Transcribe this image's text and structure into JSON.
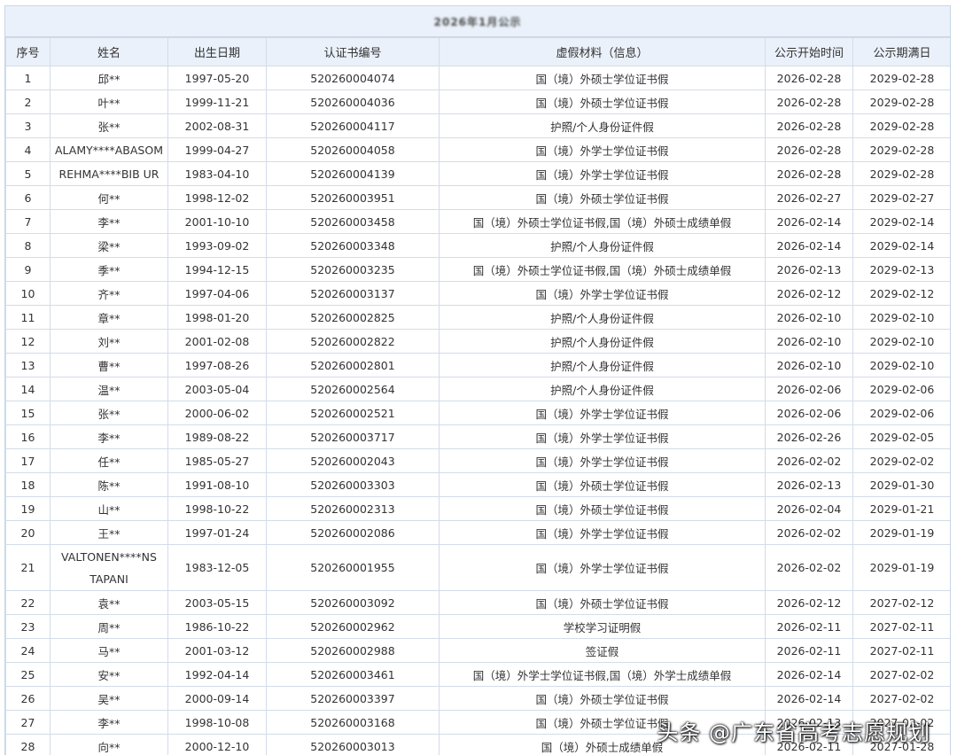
{
  "title": "2026年1月公示",
  "columns": [
    "序号",
    "姓名",
    "出生日期",
    "认证书编号",
    "虚假材料（信息）",
    "公示开始时间",
    "公示期满日"
  ],
  "rows": [
    [
      "1",
      "邱**",
      "1997-05-20",
      "520260004074",
      "国（境）外硕士学位证书假",
      "2026-02-28",
      "2029-02-28"
    ],
    [
      "2",
      "叶**",
      "1999-11-21",
      "520260004036",
      "国（境）外硕士学位证书假",
      "2026-02-28",
      "2029-02-28"
    ],
    [
      "3",
      "张**",
      "2002-08-31",
      "520260004117",
      "护照/个人身份证件假",
      "2026-02-28",
      "2029-02-28"
    ],
    [
      "4",
      "ALAMY****ABASOM",
      "1999-04-27",
      "520260004058",
      "国（境）外学士学位证书假",
      "2026-02-28",
      "2029-02-28"
    ],
    [
      "5",
      "REHMA****BIB UR",
      "1983-04-10",
      "520260004139",
      "国（境）外学士学位证书假",
      "2026-02-28",
      "2029-02-28"
    ],
    [
      "6",
      "何**",
      "1998-12-02",
      "520260003951",
      "国（境）外硕士学位证书假",
      "2026-02-27",
      "2029-02-27"
    ],
    [
      "7",
      "李**",
      "2001-10-10",
      "520260003458",
      "国（境）外硕士学位证书假,国（境）外硕士成绩单假",
      "2026-02-14",
      "2029-02-14"
    ],
    [
      "8",
      "梁**",
      "1993-09-02",
      "520260003348",
      "护照/个人身份证件假",
      "2026-02-14",
      "2029-02-14"
    ],
    [
      "9",
      "季**",
      "1994-12-15",
      "520260003235",
      "国（境）外硕士学位证书假,国（境）外硕士成绩单假",
      "2026-02-13",
      "2029-02-13"
    ],
    [
      "10",
      "齐**",
      "1997-04-06",
      "520260003137",
      "国（境）外学士学位证书假",
      "2026-02-12",
      "2029-02-12"
    ],
    [
      "11",
      "章**",
      "1998-01-20",
      "520260002825",
      "护照/个人身份证件假",
      "2026-02-10",
      "2029-02-10"
    ],
    [
      "12",
      "刘**",
      "2001-02-08",
      "520260002822",
      "护照/个人身份证件假",
      "2026-02-10",
      "2029-02-10"
    ],
    [
      "13",
      "曹**",
      "1997-08-26",
      "520260002801",
      "护照/个人身份证件假",
      "2026-02-10",
      "2029-02-10"
    ],
    [
      "14",
      "温**",
      "2003-05-04",
      "520260002564",
      "护照/个人身份证件假",
      "2026-02-06",
      "2029-02-06"
    ],
    [
      "15",
      "张**",
      "2000-06-02",
      "520260002521",
      "国（境）外学士学位证书假",
      "2026-02-06",
      "2029-02-06"
    ],
    [
      "16",
      "李**",
      "1989-08-22",
      "520260003717",
      "国（境）外学士学位证书假",
      "2026-02-26",
      "2029-02-05"
    ],
    [
      "17",
      "任**",
      "1985-05-27",
      "520260002043",
      "国（境）外学士学位证书假",
      "2026-02-02",
      "2029-02-02"
    ],
    [
      "18",
      "陈**",
      "1991-08-10",
      "520260003303",
      "国（境）外硕士学位证书假",
      "2026-02-13",
      "2029-01-30"
    ],
    [
      "19",
      "山**",
      "1998-10-22",
      "520260002313",
      "国（境）外硕士学位证书假",
      "2026-02-04",
      "2029-01-21"
    ],
    [
      "20",
      "王**",
      "1997-01-24",
      "520260002086",
      "国（境）外学士学位证书假",
      "2026-02-02",
      "2029-01-19"
    ],
    [
      "21",
      "VALTONEN****NS TAPANI",
      "1983-12-05",
      "520260001955",
      "国（境）外学士学位证书假",
      "2026-02-02",
      "2029-01-19"
    ],
    [
      "22",
      "袁**",
      "2003-05-15",
      "520260003092",
      "国（境）外硕士学位证书假",
      "2026-02-12",
      "2027-02-12"
    ],
    [
      "23",
      "周**",
      "1986-10-22",
      "520260002962",
      "学校学习证明假",
      "2026-02-11",
      "2027-02-11"
    ],
    [
      "24",
      "马**",
      "2001-03-12",
      "520260002988",
      "签证假",
      "2026-02-11",
      "2027-02-11"
    ],
    [
      "25",
      "安**",
      "1992-04-14",
      "520260003461",
      "国（境）外学士学位证书假,国（境）外学士成绩单假",
      "2026-02-14",
      "2027-02-02"
    ],
    [
      "26",
      "吴**",
      "2000-09-14",
      "520260003397",
      "国（境）外硕士学位证书假",
      "2026-02-14",
      "2027-02-02"
    ],
    [
      "27",
      "李**",
      "1998-10-08",
      "520260003168",
      "国（境）外硕士学位证书假",
      "2026-02-13",
      "2027-02-02"
    ],
    [
      "28",
      "向**",
      "2000-12-10",
      "520260003013",
      "国（境）外硕士成绩单假",
      "2026-02-11",
      "2027-01-28"
    ]
  ],
  "watermark": "头条 @广东省高考志愿规划"
}
